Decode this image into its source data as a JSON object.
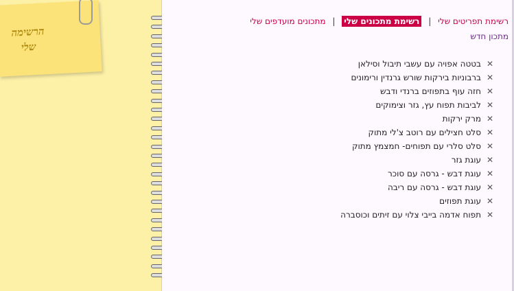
{
  "notebook": {
    "sticky_title": "הרשימה שלי"
  },
  "nav": {
    "items": [
      {
        "label": "רשימת תפריטים שלי"
      },
      {
        "label": "רשימת מתכונים שלי",
        "active": true
      },
      {
        "label": "מתכונים מועדפים שלי"
      }
    ],
    "separator": "|",
    "new_recipe": "מתכון חדש"
  },
  "recipes": [
    "בטטה אפויה עם עשבי תיבול וסילאן",
    "ברבוניות בירקות שורש גרנדין ורימונים",
    "חזה עוף בתפוזים ברנדי ודבש",
    "לביבות תפוח עץ, גזר וצימוקים",
    "מרק ירקות",
    "סלט חצילים עם רוטב צ'לי מתוק",
    "סלט סלרי עם תפוחים- חמצמץ מתוק",
    "עוגת גזר",
    "עוגת דבש - גרסה עם סוכר",
    "עוגת דבש - גרסה עם ריבה",
    "עוגת תפוזים",
    "תפוח אדמה בייבי צלוי עם זיתים וכוסברה"
  ],
  "icons": {
    "remove": "close-icon"
  },
  "colors": {
    "accent": "#cc0044",
    "new_link": "#6a2a8a",
    "paper": "#fdf1a8"
  }
}
